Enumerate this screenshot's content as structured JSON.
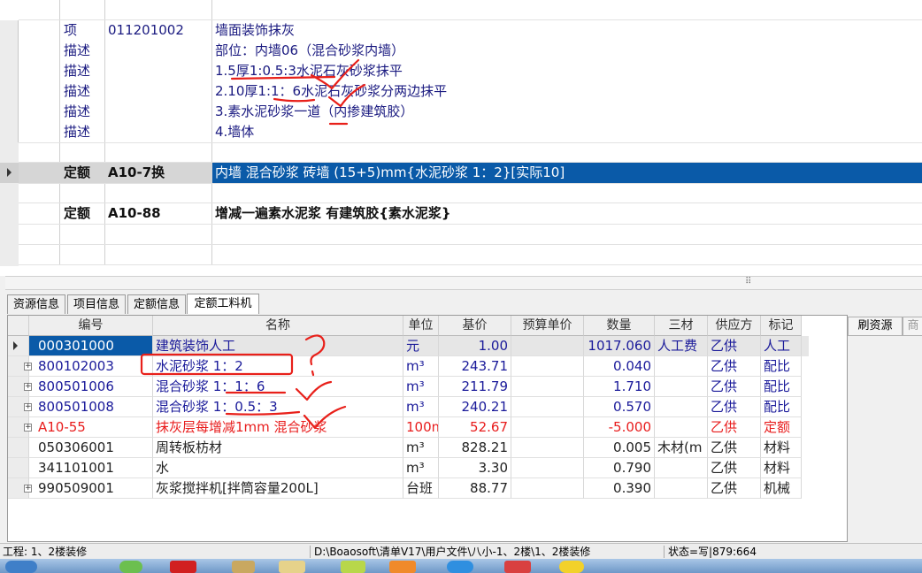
{
  "top_grid": {
    "rows": [
      {
        "kind": "项",
        "code": "011201002",
        "desc": "墙面装饰抹灰"
      },
      {
        "kind": "描述",
        "code": "",
        "desc": "部位：内墙06（混合砂浆内墙）"
      },
      {
        "kind": "描述",
        "code": "",
        "desc": "1.5厚1:0.5:3水泥石灰砂浆抹平"
      },
      {
        "kind": "描述",
        "code": "",
        "desc": "2.10厚1:1：6水泥石灰砂浆分两边抹平"
      },
      {
        "kind": "描述",
        "code": "",
        "desc": "3.素水泥砂浆一道（内掺建筑胶）"
      },
      {
        "kind": "描述",
        "code": "",
        "desc": "4.墙体"
      },
      {
        "kind": "定额",
        "code": "A10-7换",
        "desc": "内墙 混合砂浆 砖墙 (15+5)mm{水泥砂浆 1：2}[实际10]"
      },
      {
        "kind": "定额",
        "code": "A10-88",
        "desc": "增减一遍素水泥浆 有建筑胶{素水泥浆}"
      }
    ],
    "scroll_grip": "⠿"
  },
  "tabs": [
    "资源信息",
    "项目信息",
    "定额信息",
    "定额工料机"
  ],
  "bottom_grid": {
    "headers": [
      "编号",
      "名称",
      "单位",
      "基价",
      "预算单价",
      "数量",
      "三材",
      "供应方",
      "标记"
    ],
    "rows": [
      {
        "code": "000301000",
        "name": "建筑装饰人工",
        "unit": "元",
        "base": "1.00",
        "budget": "",
        "qty": "1017.060",
        "mat": "人工费",
        "supplier": "乙供",
        "mark": "人工"
      },
      {
        "code": "800102003",
        "name": "水泥砂浆 1：2",
        "unit": "m³",
        "base": "243.71",
        "budget": "",
        "qty": "0.040",
        "mat": "",
        "supplier": "乙供",
        "mark": "配比"
      },
      {
        "code": "800501006",
        "name": "混合砂浆 1：1：6",
        "unit": "m³",
        "base": "211.79",
        "budget": "",
        "qty": "1.710",
        "mat": "",
        "supplier": "乙供",
        "mark": "配比"
      },
      {
        "code": "800501008",
        "name": "混合砂浆 1：0.5：3",
        "unit": "m³",
        "base": "240.21",
        "budget": "",
        "qty": "0.570",
        "mat": "",
        "supplier": "乙供",
        "mark": "配比"
      },
      {
        "code": "A10-55",
        "name": "抹灰层每增减1mm 混合砂浆",
        "unit": "100m",
        "base": "52.67",
        "budget": "",
        "qty": "-5.000",
        "mat": "",
        "supplier": "乙供",
        "mark": "定额"
      },
      {
        "code": "050306001",
        "name": "周转板枋材",
        "unit": "m³",
        "base": "828.21",
        "budget": "",
        "qty": "0.005",
        "mat": "木材(m",
        "supplier": "乙供",
        "mark": "材料"
      },
      {
        "code": "341101001",
        "name": "水",
        "unit": "m³",
        "base": "3.30",
        "budget": "",
        "qty": "0.790",
        "mat": "",
        "supplier": "乙供",
        "mark": "材料"
      },
      {
        "code": "990509001",
        "name": "灰浆搅拌机[拌筒容量200L]",
        "unit": "台班",
        "base": "88.77",
        "budget": "",
        "qty": "0.390",
        "mat": "",
        "supplier": "乙供",
        "mark": "机械"
      }
    ]
  },
  "side_buttons": [
    "刷资源",
    "商"
  ],
  "status": {
    "project": "工程: 1、2楼装修",
    "path": "D:\\Boaosoft\\清单V17\\用户文件\\八小-1、2楼\\1、2楼装修",
    "state": "状态=写|879:664"
  },
  "colors": {
    "selected_row": "#0a5aa8",
    "code_blue": "#1a1a9a",
    "quota_red": "#e81c1c",
    "annotation": "#e8201a"
  }
}
